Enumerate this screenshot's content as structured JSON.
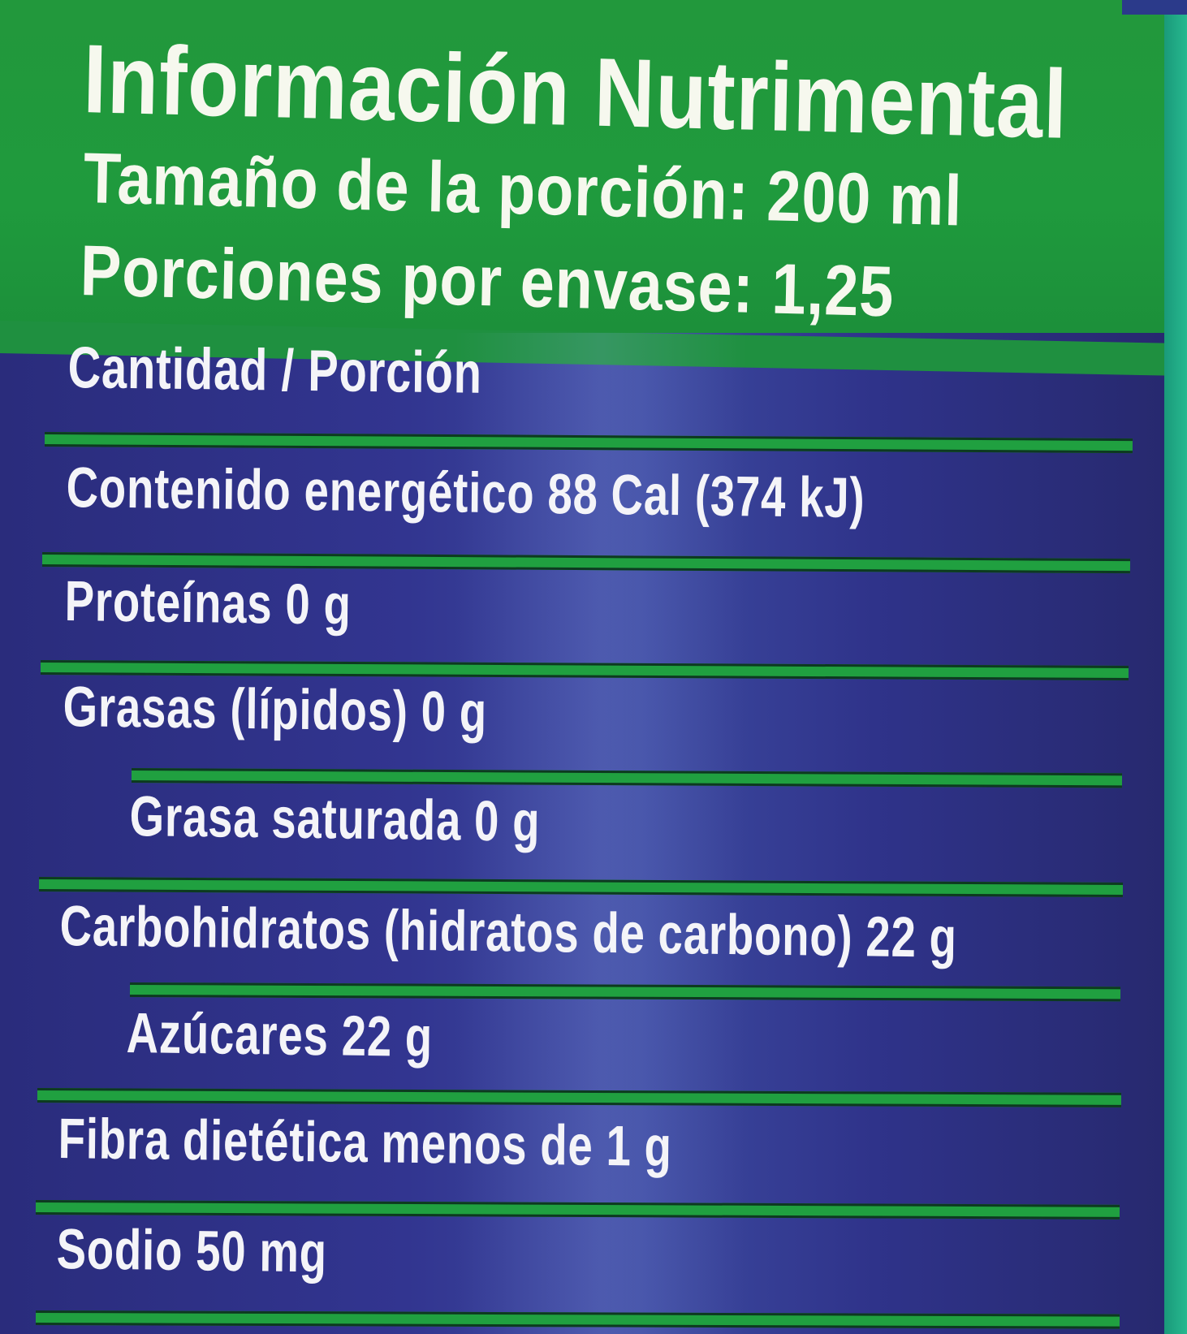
{
  "label": {
    "title": "Información Nutrimental",
    "serving_size": "Tamaño de la porción: 200 ml",
    "servings_per_container": "Porciones por envase: 1,25",
    "amount_per_serving": "Cantidad / Porción",
    "rows": [
      {
        "text": "Contenido energético 88 Cal (374 kJ)"
      },
      {
        "text": "Proteínas 0 g"
      },
      {
        "text": "Grasas (lípidos) 0 g"
      },
      {
        "text": "Grasa saturada 0 g"
      },
      {
        "text": "Carbohidratos (hidratos de carbono) 22 g"
      },
      {
        "text": "Azúcares 22 g"
      },
      {
        "text": "Fibra dietética menos de  1 g"
      },
      {
        "text": "Sodio 50 mg"
      }
    ]
  },
  "colors": {
    "header_green": "#1f9a3d",
    "panel_blue": "#2f338a",
    "rule_green": "#20a040",
    "text_white": "#f4f4f8"
  }
}
